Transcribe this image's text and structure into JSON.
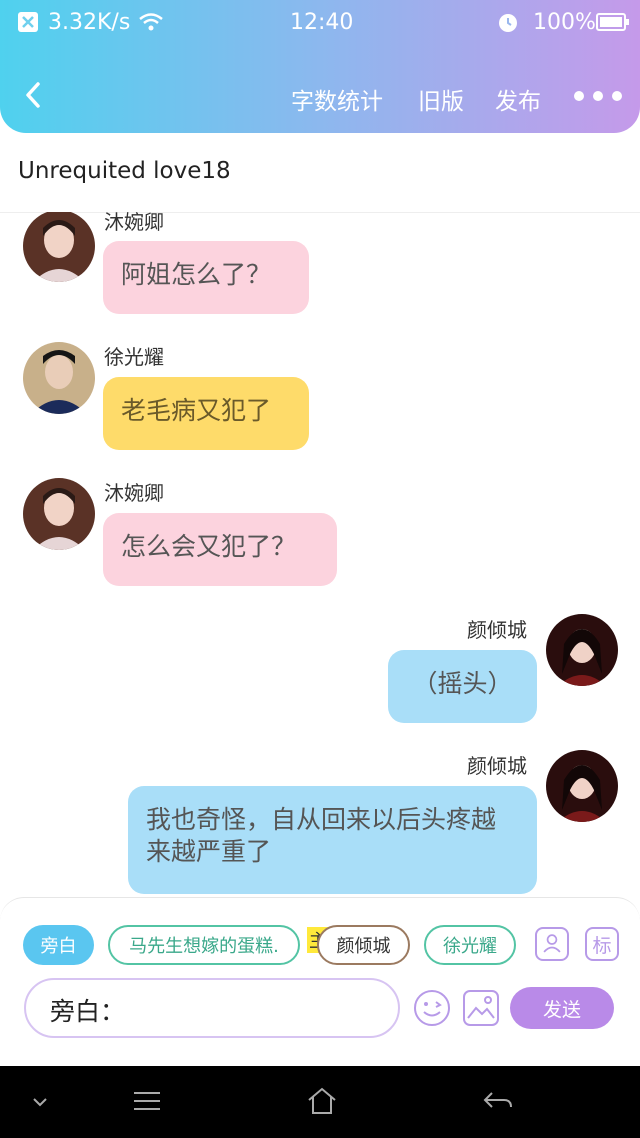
{
  "status_bar": {
    "net_speed": "3.32K/s",
    "time": "12:40",
    "battery": "100%"
  },
  "header": {
    "actions": [
      "字数统计",
      "旧版",
      "发布"
    ],
    "more_icon": "more-dots-icon",
    "back_icon": "back-chevron-icon"
  },
  "story": {
    "title": "Unrequited love18"
  },
  "messages": [
    {
      "speaker": "沐婉卿",
      "text": "阿姐怎么了？",
      "side": "left",
      "color": "#fcd3de"
    },
    {
      "speaker": "徐光耀",
      "text": "老毛病又犯了",
      "side": "left",
      "color": "#fedb6a"
    },
    {
      "speaker": "沐婉卿",
      "text": "怎么会又犯了？",
      "side": "left",
      "color": "#fcd3de"
    },
    {
      "speaker": "颜倾城",
      "text": "（摇头）",
      "side": "right",
      "color": "#a9def8"
    },
    {
      "speaker": "颜倾城",
      "text": "我也奇怪，自从回来以后头疼越来越严重了",
      "side": "right",
      "color": "#a9def8"
    }
  ],
  "characters": [
    "旁白",
    "马先生想嫁的蛋糕.",
    "颜倾城",
    "徐光耀"
  ],
  "main_marker": "主",
  "input": {
    "prefix": "旁白："
  },
  "send_label": "发送",
  "tool_icons": [
    "character-icon",
    "tag-icon",
    "emoji-icon",
    "image-icon"
  ],
  "tag_icon_label": "标",
  "colors": {
    "accent": "#b98ae8",
    "header_start": "#4fd1ee",
    "header_end": "#c59aea"
  }
}
